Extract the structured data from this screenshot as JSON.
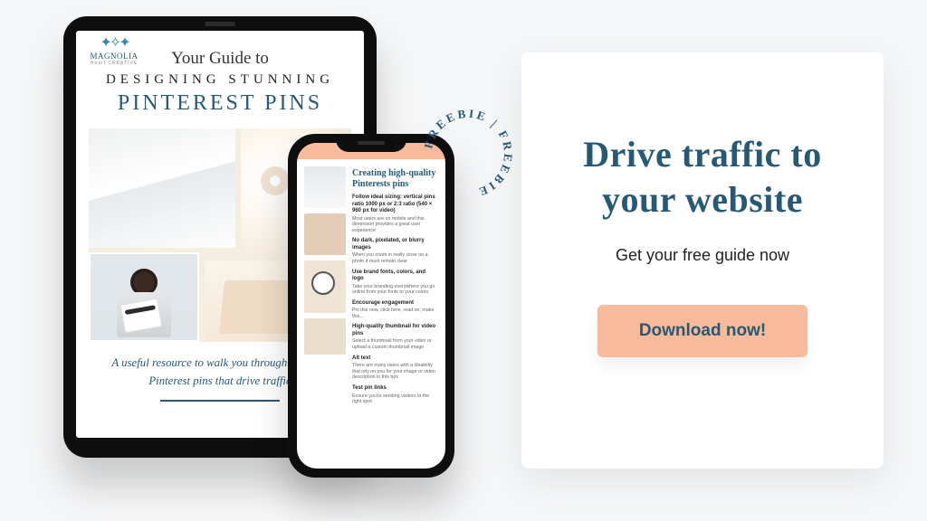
{
  "tablet": {
    "logo_brand": "MAGNOLIA",
    "logo_tag": "Heart CREATIVE",
    "pretitle": "Your Guide to",
    "title_line1": "DESIGNING STUNNING",
    "title_line2": "PINTEREST PINS",
    "blurb": "A useful resource to walk you through creating Pinterest pins that drive traffic"
  },
  "phone": {
    "heading": "Creating high-quality Pinterests pins",
    "tips": [
      {
        "bold": "Follow ideal sizing: vertical pins ratio 1000 px or 2:3 ratio (540 × 960 px for video)",
        "body": "Most users are on mobile and this dimension provides a great user experience"
      },
      {
        "bold": "No dark, pixelated, or blurry images",
        "body": "When you zoom in really close on a photo it must remain clear"
      },
      {
        "bold": "Use brand fonts, colors, and logo",
        "body": "Take your branding everywhere you go online from your fonts to your colors"
      },
      {
        "bold": "Encourage engagement",
        "body": "Pin this now, click here, read on, make this…"
      },
      {
        "bold": "High-quality thumbnail for video pins",
        "body": "Select a thumbnail from your video or upload a custom thumbnail image"
      },
      {
        "bold": "Alt text",
        "body": "There are many users with a disability that rely on you for your image or video description in this box"
      },
      {
        "bold": "Test pin links",
        "body": "Ensure you're sending visitors to the right spot"
      }
    ]
  },
  "badge_text": "FREEBIE   |   FREEBIE",
  "cta": {
    "heading": "Drive traffic to your website",
    "sub": "Get your free guide now",
    "button": "Download now!"
  }
}
